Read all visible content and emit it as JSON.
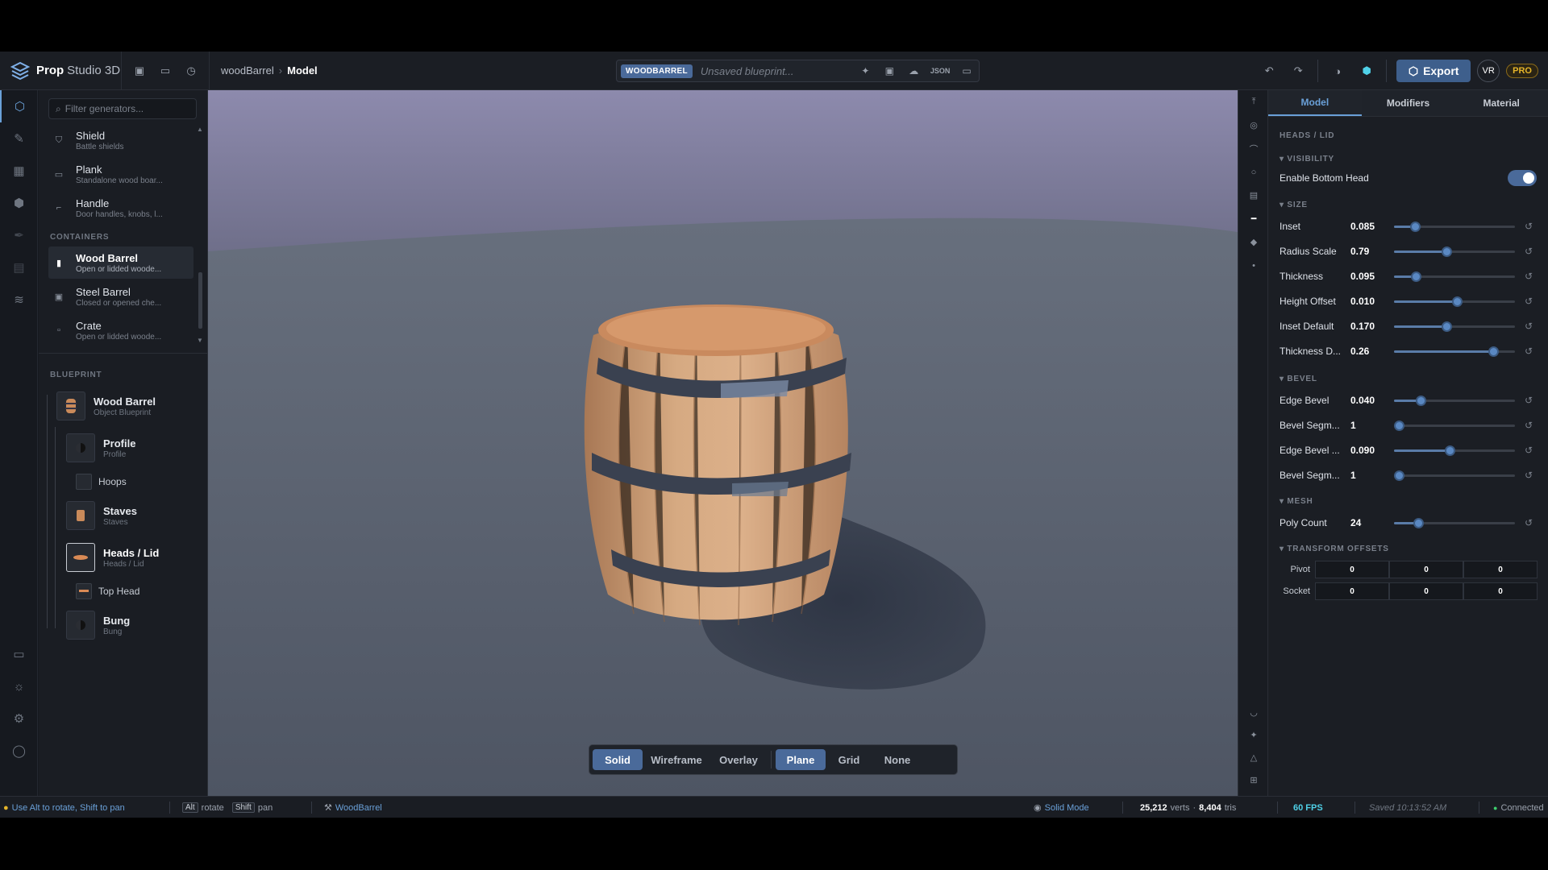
{
  "app": {
    "name_bold": "Prop",
    "name_rest": "Studio 3D"
  },
  "breadcrumb": {
    "project": "woodBarrel",
    "sep": "›",
    "current": "Model"
  },
  "blueprint_bar": {
    "tag": "WOODBARREL",
    "placeholder": "Unsaved blueprint...",
    "json_label": "JSON"
  },
  "toolbar": {
    "export_label": "Export",
    "vr_label": "VR",
    "pro_label": "PRO"
  },
  "left_panel": {
    "filter_placeholder": "Filter generators...",
    "generators": [
      {
        "name": "Shield",
        "desc": "Battle shields"
      },
      {
        "name": "Plank",
        "desc": "Standalone wood boar..."
      },
      {
        "name": "Handle",
        "desc": "Door handles, knobs, l..."
      }
    ],
    "containers_heading": "CONTAINERS",
    "containers": [
      {
        "name": "Wood Barrel",
        "desc": "Open or lidded woode...",
        "selected": true
      },
      {
        "name": "Steel Barrel",
        "desc": "Closed or opened che..."
      },
      {
        "name": "Crate",
        "desc": "Open or lidded woode..."
      }
    ],
    "blueprint_heading": "BLUEPRINT",
    "blueprint": {
      "root": {
        "name": "Wood Barrel",
        "desc": "Object Blueprint"
      },
      "profile": {
        "name": "Profile",
        "desc": "Profile"
      },
      "hoops": {
        "name": "Hoops"
      },
      "staves": {
        "name": "Staves",
        "desc": "Staves"
      },
      "heads": {
        "name": "Heads / Lid",
        "desc": "Heads / Lid"
      },
      "top_head": {
        "name": "Top Head"
      },
      "bung": {
        "name": "Bung",
        "desc": "Bung"
      }
    }
  },
  "viewport": {
    "render_modes": [
      "Solid",
      "Wireframe",
      "Overlay"
    ],
    "active_render": "Solid",
    "ground_modes": [
      "Plane",
      "Grid",
      "None"
    ],
    "active_ground": "Plane"
  },
  "right_panel": {
    "tabs": [
      "Model",
      "Modifiers",
      "Material"
    ],
    "active_tab": "Model",
    "section_title": "HEADS / LID",
    "visibility": {
      "heading": "▾ VISIBILITY",
      "label": "Enable Bottom Head",
      "enabled": true
    },
    "size": {
      "heading": "▾ SIZE",
      "params": [
        {
          "label": "Inset",
          "value": "0.085",
          "fraction": 0.17
        },
        {
          "label": "Radius Scale",
          "value": "0.79",
          "fraction": 0.43
        },
        {
          "label": "Thickness",
          "value": "0.095",
          "fraction": 0.18
        },
        {
          "label": "Height Offset",
          "value": "0.010",
          "fraction": 0.52
        },
        {
          "label": "Inset Default",
          "value": "0.170",
          "fraction": 0.43
        },
        {
          "label": "Thickness D...",
          "value": "0.26",
          "fraction": 0.82
        }
      ]
    },
    "bevel": {
      "heading": "▾ BEVEL",
      "params": [
        {
          "label": "Edge Bevel",
          "value": "0.040",
          "fraction": 0.22
        },
        {
          "label": "Bevel Segm...",
          "value": "1",
          "fraction": 0.04
        },
        {
          "label": "Edge Bevel ...",
          "value": "0.090",
          "fraction": 0.46
        },
        {
          "label": "Bevel Segm...",
          "value": "1",
          "fraction": 0.04
        }
      ]
    },
    "mesh": {
      "heading": "▾ MESH",
      "params": [
        {
          "label": "Poly Count",
          "value": "24",
          "fraction": 0.2
        }
      ]
    },
    "transform": {
      "heading": "▾ TRANSFORM OFFSETS",
      "rows": [
        {
          "label": "Pivot",
          "values": [
            "0",
            "0",
            "0"
          ]
        },
        {
          "label": "Socket",
          "values": [
            "0",
            "0",
            "0"
          ]
        }
      ]
    }
  },
  "status": {
    "hint": "Use Alt to rotate, Shift to pan",
    "key_alt": "Alt",
    "rotate": "rotate",
    "key_shift": "Shift",
    "pan": "pan",
    "object": "WoodBarrel",
    "mode": "Solid Mode",
    "verts": "25,212",
    "verts_label": "verts",
    "sep": "·",
    "tris": "8,404",
    "tris_label": "tris",
    "fps": "60 FPS",
    "saved": "Saved 10:13:52 AM",
    "connection": "Connected"
  },
  "colors": {
    "accent": "#6aa0d8",
    "active_button": "#4a6a9a",
    "fps": "#4fd1e8",
    "connected": "#3ecf6e",
    "pro": "#e5b52a"
  }
}
